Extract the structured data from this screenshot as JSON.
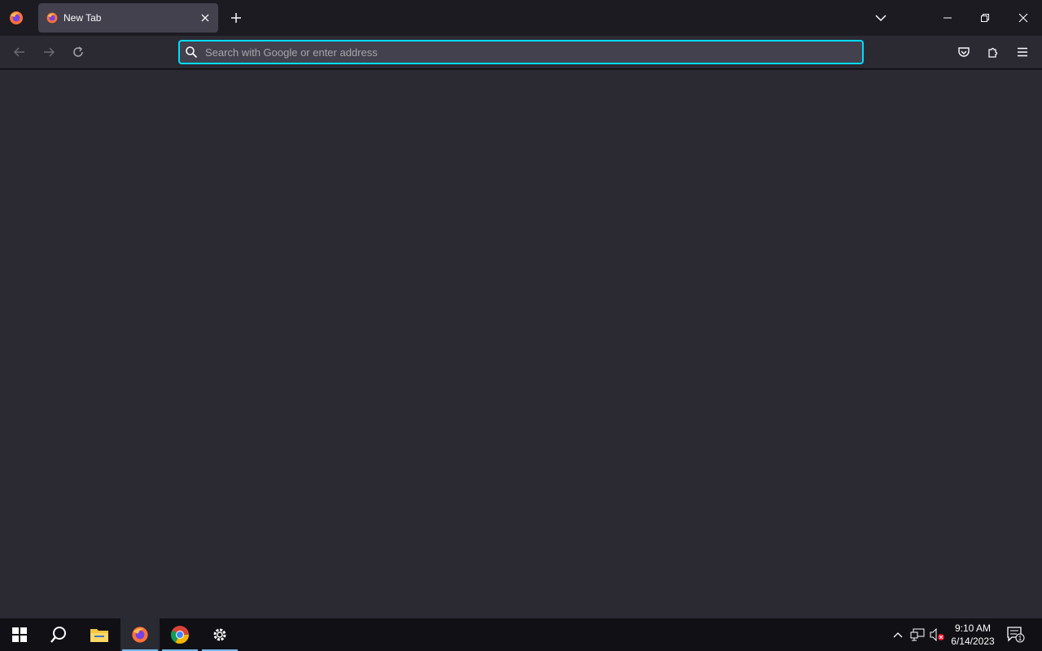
{
  "browser": {
    "tab": {
      "title": "New Tab"
    },
    "urlbar": {
      "placeholder": "Search with Google or enter address",
      "value": ""
    }
  },
  "taskbar": {
    "clock": {
      "time": "9:10 AM",
      "date": "6/14/2023"
    },
    "notification_count": "1"
  },
  "colors": {
    "accent": "#00ddff",
    "frame": "#1c1b22",
    "toolbar": "#2b2a33",
    "field": "#42414d"
  }
}
